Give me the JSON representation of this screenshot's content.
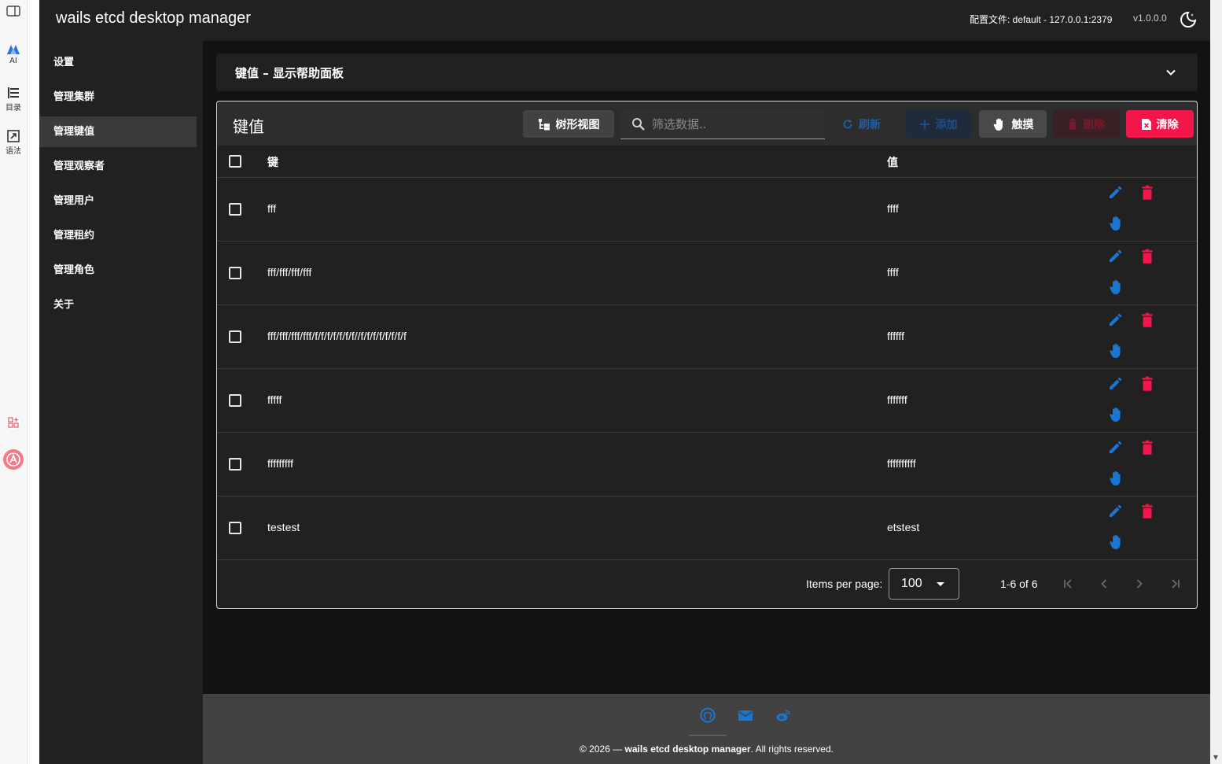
{
  "browser_strip": {
    "ai_label": "AI",
    "toc_label": "目录",
    "grammar_label": "语法"
  },
  "header": {
    "app_title": "wails etcd desktop manager",
    "profile_info": "配置文件: default - 127.0.0.1:2379",
    "version": "v1.0.0.0",
    "theme_icon": "moon-icon"
  },
  "sidebar": {
    "items": [
      {
        "label": "设置",
        "active": false
      },
      {
        "label": "管理集群",
        "active": false
      },
      {
        "label": "管理键值",
        "active": true
      },
      {
        "label": "管理观察者",
        "active": false
      },
      {
        "label": "管理用户",
        "active": false
      },
      {
        "label": "管理租约",
        "active": false
      },
      {
        "label": "管理角色",
        "active": false
      },
      {
        "label": "关于",
        "active": false
      }
    ]
  },
  "help_panel": {
    "title": "键值 – 显示帮助面板"
  },
  "kv_card": {
    "title": "键值",
    "toolbar": {
      "tree_view_label": "树形视图",
      "search_placeholder": "筛选数据..",
      "search_value": "",
      "refresh_label": "刷新",
      "add_label": "添加",
      "touch_label": "触摸",
      "delete_label": "删除",
      "clear_label": "清除"
    },
    "columns": {
      "key": "键",
      "value": "值"
    },
    "rows": [
      {
        "key": "fff",
        "value": "ffff"
      },
      {
        "key": "fff/fff/fff/fff",
        "value": "ffff"
      },
      {
        "key": "fff/fff/fff/fff/f/f/f/f/f/f/f//f/f/f/f/f/f/f/f",
        "value": "ffffff"
      },
      {
        "key": "fffff",
        "value": "fffffff"
      },
      {
        "key": "fffffffff",
        "value": "ffffffffff"
      },
      {
        "key": "testest",
        "value": "etstest"
      }
    ],
    "pagination": {
      "items_per_page_label": "Items per page:",
      "items_per_page_value": "100",
      "range_text": "1-6 of 6"
    }
  },
  "footer": {
    "copyright_prefix": "© 2026 — ",
    "app_name": "wails etcd desktop manager",
    "copyright_suffix": ". All rights reserved."
  },
  "colors": {
    "app_bg": "#121212",
    "surface": "#212121",
    "primary_blue": "#1976d2",
    "danger_red": "#f2164a"
  }
}
